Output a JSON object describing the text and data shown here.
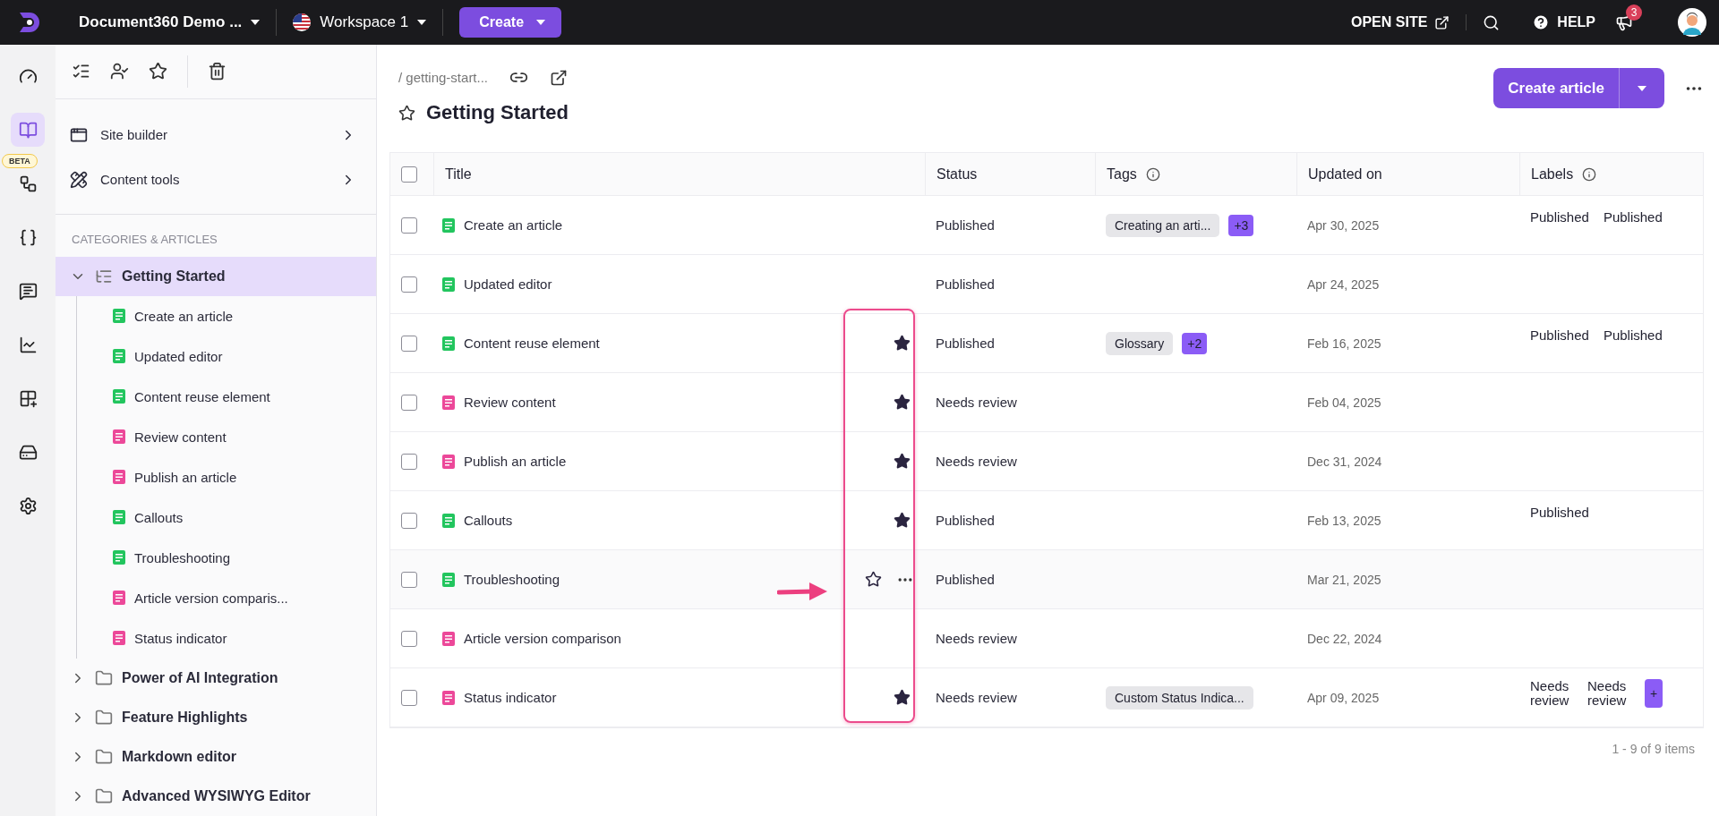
{
  "top_bar": {
    "project": "Document360 Demo ...",
    "workspace": "Workspace 1",
    "create_button": "Create",
    "open_site": "OPEN SITE",
    "help": "HELP",
    "notification_count": "3"
  },
  "rail": [
    {
      "kind": "dashboard",
      "selected": false
    },
    {
      "kind": "documents",
      "selected": true
    },
    {
      "kind": "workflow",
      "selected": false,
      "badge": "BETA"
    },
    {
      "kind": "api",
      "selected": false
    },
    {
      "kind": "feedback",
      "selected": false
    },
    {
      "kind": "analytics",
      "selected": false
    },
    {
      "kind": "extensions",
      "selected": false
    },
    {
      "kind": "widgets",
      "selected": false
    },
    {
      "kind": "settings",
      "selected": false
    }
  ],
  "sidebar": {
    "tools": [
      {
        "kind": "site",
        "label": "Site builder"
      },
      {
        "kind": "content",
        "label": "Content tools"
      }
    ],
    "section_heading": "CATEGORIES & ARTICLES",
    "tree": [
      {
        "kind": "category",
        "label": "Getting Started",
        "expanded": true,
        "selected": true,
        "children": [
          {
            "label": "Create an article",
            "color": "#22c55e"
          },
          {
            "label": "Updated editor",
            "color": "#22c55e"
          },
          {
            "label": "Content reuse element",
            "color": "#22c55e"
          },
          {
            "label": "Review content",
            "color": "#ec4899"
          },
          {
            "label": "Publish an article",
            "color": "#ec4899"
          },
          {
            "label": "Callouts",
            "color": "#22c55e"
          },
          {
            "label": "Troubleshooting",
            "color": "#22c55e"
          },
          {
            "label": "Article version comparis...",
            "color": "#ec4899"
          },
          {
            "label": "Status indicator",
            "color": "#ec4899"
          }
        ]
      },
      {
        "kind": "folder",
        "label": "Power of AI Integration",
        "expanded": false,
        "selected": false
      },
      {
        "kind": "folder",
        "label": "Feature Highlights",
        "expanded": false,
        "selected": false
      },
      {
        "kind": "folder",
        "label": "Markdown editor",
        "expanded": false,
        "selected": false
      },
      {
        "kind": "folder",
        "label": "Advanced WYSIWYG Editor",
        "expanded": false,
        "selected": false
      }
    ]
  },
  "page": {
    "breadcrumb": "/ getting-start...",
    "title": "Getting Started",
    "favorite": false,
    "create_button": "Create article"
  },
  "table": {
    "select_all_checked": false,
    "columns": [
      {
        "label": "Title",
        "info": false
      },
      {
        "label": "Status",
        "info": false
      },
      {
        "label": "Tags",
        "info": true
      },
      {
        "label": "Updated on",
        "info": false
      },
      {
        "label": "Labels",
        "info": true
      }
    ],
    "rows": [
      {
        "checked": false,
        "title": "Create an article",
        "color": "#22c55e",
        "starred": false,
        "hovered": false,
        "status": "Published",
        "tags": [
          "Creating an arti..."
        ],
        "more_tags": "+3",
        "updated": "Apr 30, 2025",
        "labels": [
          "Published",
          "Published"
        ]
      },
      {
        "checked": false,
        "title": "Updated editor",
        "color": "#22c55e",
        "starred": false,
        "hovered": false,
        "status": "Published",
        "tags": [],
        "updated": "Apr 24, 2025",
        "labels": []
      },
      {
        "checked": false,
        "title": "Content reuse element",
        "color": "#22c55e",
        "starred": true,
        "hovered": false,
        "status": "Published",
        "tags": [
          "Glossary"
        ],
        "more_tags": "+2",
        "updated": "Feb 16, 2025",
        "labels": [
          "Published",
          "Published"
        ]
      },
      {
        "checked": false,
        "title": "Review content",
        "color": "#ec4899",
        "starred": true,
        "hovered": false,
        "status": "Needs review",
        "tags": [],
        "updated": "Feb 04, 2025",
        "labels": []
      },
      {
        "checked": false,
        "title": "Publish an article",
        "color": "#ec4899",
        "starred": true,
        "hovered": false,
        "status": "Needs review",
        "tags": [],
        "updated": "Dec 31, 2024",
        "labels": []
      },
      {
        "checked": false,
        "title": "Callouts",
        "color": "#22c55e",
        "starred": true,
        "hovered": false,
        "status": "Published",
        "tags": [],
        "updated": "Feb 13, 2025",
        "labels": [
          "Published"
        ]
      },
      {
        "checked": false,
        "title": "Troubleshooting",
        "color": "#22c55e",
        "starred": false,
        "hovered": true,
        "status": "Published",
        "tags": [],
        "updated": "Mar 21, 2025",
        "labels": []
      },
      {
        "checked": false,
        "title": "Article version comparison",
        "color": "#ec4899",
        "starred": false,
        "hovered": false,
        "status": "Needs review",
        "tags": [],
        "updated": "Dec 22, 2024",
        "labels": []
      },
      {
        "checked": false,
        "title": "Status indicator",
        "color": "#ec4899",
        "starred": true,
        "hovered": false,
        "status": "Needs review",
        "tags": [
          "Custom Status Indica..."
        ],
        "updated": "Apr 09, 2025",
        "labels": [
          "Needs review",
          "Needs review"
        ],
        "more_labels": "+"
      }
    ],
    "footer": "1 - 9 of 9 items"
  },
  "annotation": {
    "kind": "highlight"
  }
}
